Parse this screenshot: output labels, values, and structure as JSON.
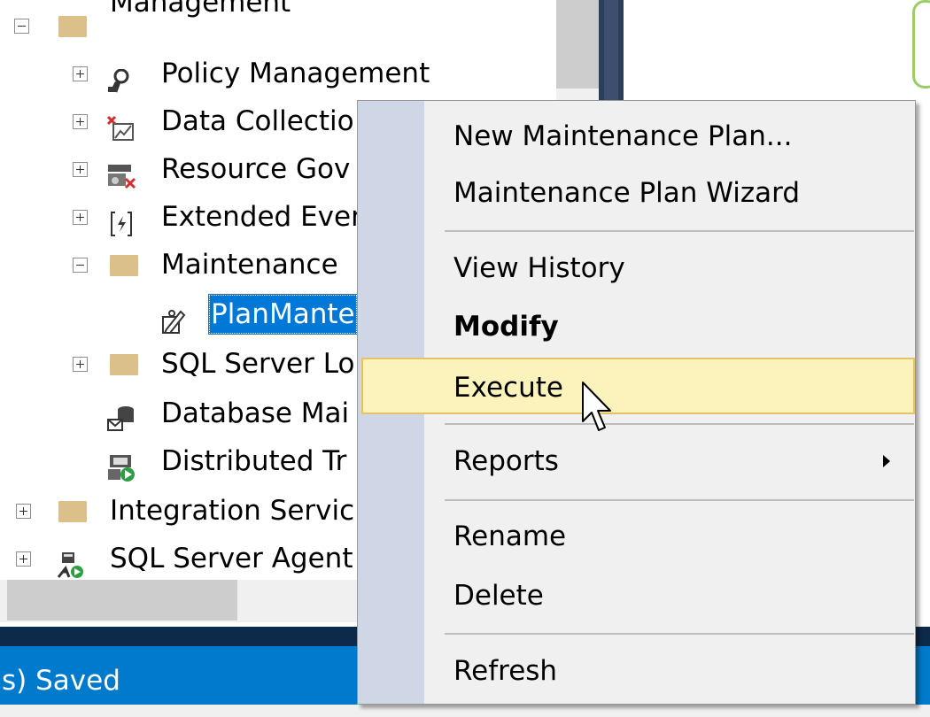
{
  "tree": {
    "items": [
      {
        "label": "Management",
        "expander": "minus",
        "icon": "folder-icon"
      },
      {
        "label": "Policy Management",
        "expander": "plus",
        "icon": "policy-icon"
      },
      {
        "label": "Data Collectio",
        "expander": "plus",
        "icon": "data-collection-icon"
      },
      {
        "label": "Resource Gov",
        "expander": "plus",
        "icon": "resource-governor-icon"
      },
      {
        "label": "Extended Ever",
        "expander": "plus",
        "icon": "extended-events-icon"
      },
      {
        "label": "Maintenance",
        "expander": "minus",
        "icon": "folder-icon"
      },
      {
        "label": "PlanMante",
        "expander": "none",
        "icon": "maintenance-plan-icon",
        "selected": true
      },
      {
        "label": "SQL Server Lo",
        "expander": "plus",
        "icon": "folder-icon"
      },
      {
        "label": "Database Mai",
        "expander": "none",
        "icon": "database-mail-icon"
      },
      {
        "label": "Distributed Tr",
        "expander": "none",
        "icon": "distributed-transaction-icon"
      },
      {
        "label": "Integration Servic",
        "expander": "plus",
        "icon": "folder-icon"
      },
      {
        "label": "SQL Server Agent",
        "expander": "plus",
        "icon": "sql-agent-icon"
      }
    ]
  },
  "statusbar": {
    "text": "s) Saved"
  },
  "context_menu": {
    "items": [
      {
        "label": "New Maintenance Plan..."
      },
      {
        "label": "Maintenance Plan Wizard"
      },
      {
        "label": "View History"
      },
      {
        "label": "Modify",
        "bold": true
      },
      {
        "label": "Execute",
        "highlighted": true
      },
      {
        "label": "Reports",
        "submenu": true
      },
      {
        "label": "Rename"
      },
      {
        "label": "Delete"
      },
      {
        "label": "Refresh"
      }
    ]
  },
  "colors": {
    "selection": "#0078d7",
    "menu_highlight": "#fcf3bc",
    "menu_highlight_border": "#e5c365",
    "status_bar": "#007acc",
    "folder": "#dcc08a"
  }
}
